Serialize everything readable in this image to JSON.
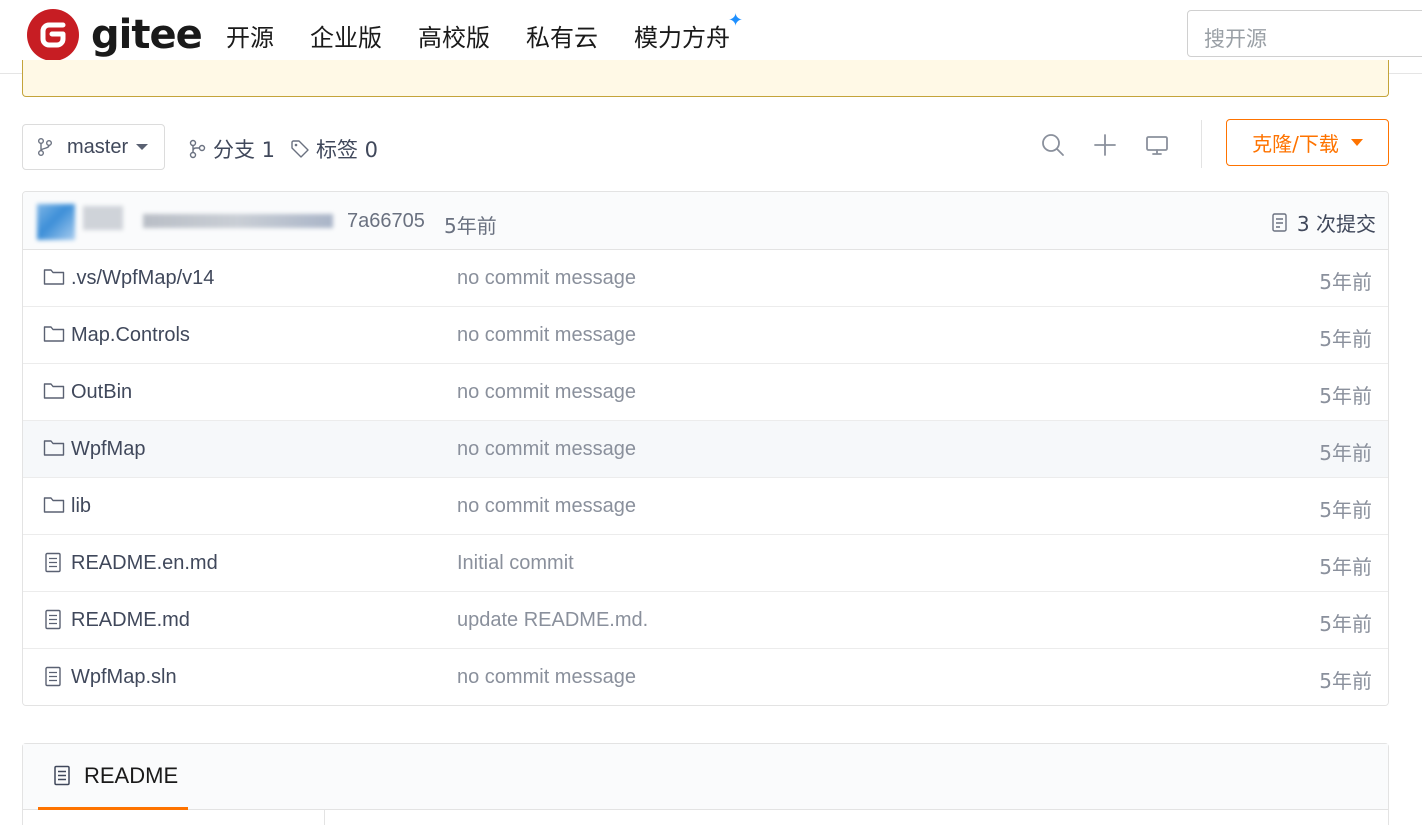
{
  "nav": {
    "brand": "gitee",
    "items": [
      "开源",
      "企业版",
      "高校版",
      "私有云",
      "模力方舟"
    ],
    "search_placeholder": "搜开源"
  },
  "repo": {
    "branch": "master",
    "branches_label": "分支 1",
    "tags_label": "标签 0",
    "clone_label": "克隆/下载"
  },
  "commit": {
    "hash": "7a66705",
    "time": "5年前",
    "count_label": "3 次提交"
  },
  "files": [
    {
      "name": ".vs/WpfMap/v14",
      "type": "folder",
      "message": "no commit message",
      "time": "5年前"
    },
    {
      "name": "Map.Controls",
      "type": "folder",
      "message": "no commit message",
      "time": "5年前"
    },
    {
      "name": "OutBin",
      "type": "folder",
      "message": "no commit message",
      "time": "5年前"
    },
    {
      "name": "WpfMap",
      "type": "folder",
      "message": "no commit message",
      "time": "5年前"
    },
    {
      "name": "lib",
      "type": "folder",
      "message": "no commit message",
      "time": "5年前"
    },
    {
      "name": "README.en.md",
      "type": "file",
      "message": "Initial commit",
      "time": "5年前"
    },
    {
      "name": "README.md",
      "type": "file",
      "message": "update README.md.",
      "time": "5年前"
    },
    {
      "name": "WpfMap.sln",
      "type": "file",
      "message": "no commit message",
      "time": "5年前"
    }
  ],
  "readme": {
    "tab_label": "README"
  },
  "colors": {
    "brand_red": "#c71d23",
    "accent_orange": "#fe7300",
    "sparkle_blue": "#1e90ff"
  }
}
